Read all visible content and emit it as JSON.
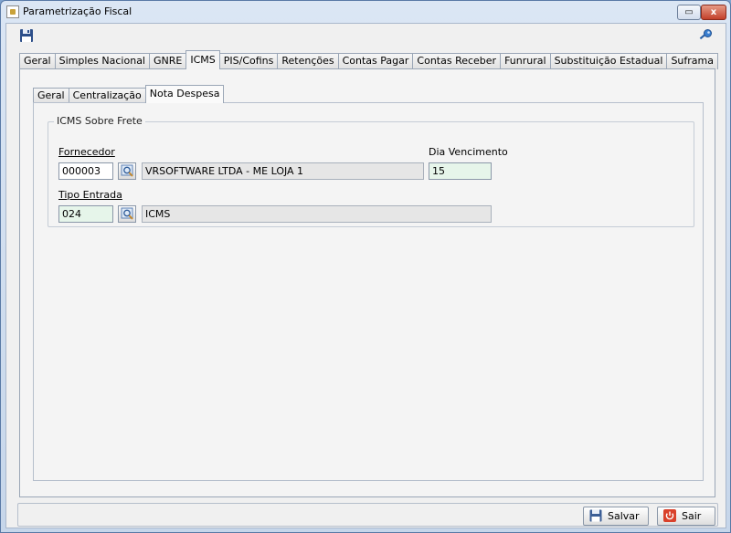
{
  "window": {
    "title": "Parametrização Fiscal",
    "maximize_glyph": "▭",
    "close_glyph": "x"
  },
  "toolbar": {
    "save_icon": "floppy-disk-icon",
    "search_icon": "key-icon"
  },
  "main_tabs": [
    {
      "label": "Geral"
    },
    {
      "label": "Simples Nacional"
    },
    {
      "label": "GNRE"
    },
    {
      "label": "ICMS"
    },
    {
      "label": "PIS/Cofins"
    },
    {
      "label": "Retenções"
    },
    {
      "label": "Contas Pagar"
    },
    {
      "label": "Contas Receber"
    },
    {
      "label": "Funrural"
    },
    {
      "label": "Substituição Estadual"
    },
    {
      "label": "Suframa"
    }
  ],
  "active_main_tab": "ICMS",
  "sub_tabs": [
    {
      "label": "Geral"
    },
    {
      "label": "Centralização"
    },
    {
      "label": "Nota Despesa"
    }
  ],
  "active_sub_tab": "Nota Despesa",
  "icms_frete": {
    "group_title": "ICMS Sobre Frete",
    "fornecedor_label": "Fornecedor",
    "fornecedor_code": "000003",
    "fornecedor_name": "VRSOFTWARE LTDA - ME LOJA 1",
    "dia_vencimento_label": "Dia Vencimento",
    "dia_vencimento": "15",
    "tipo_entrada_label": "Tipo Entrada",
    "tipo_entrada_code": "024",
    "tipo_entrada_name": "ICMS"
  },
  "footer": {
    "salvar_label": "Salvar",
    "sair_label": "Sair"
  },
  "colors": {
    "green_field": "#e6f5ea",
    "sair_icon": "#d9412b"
  }
}
